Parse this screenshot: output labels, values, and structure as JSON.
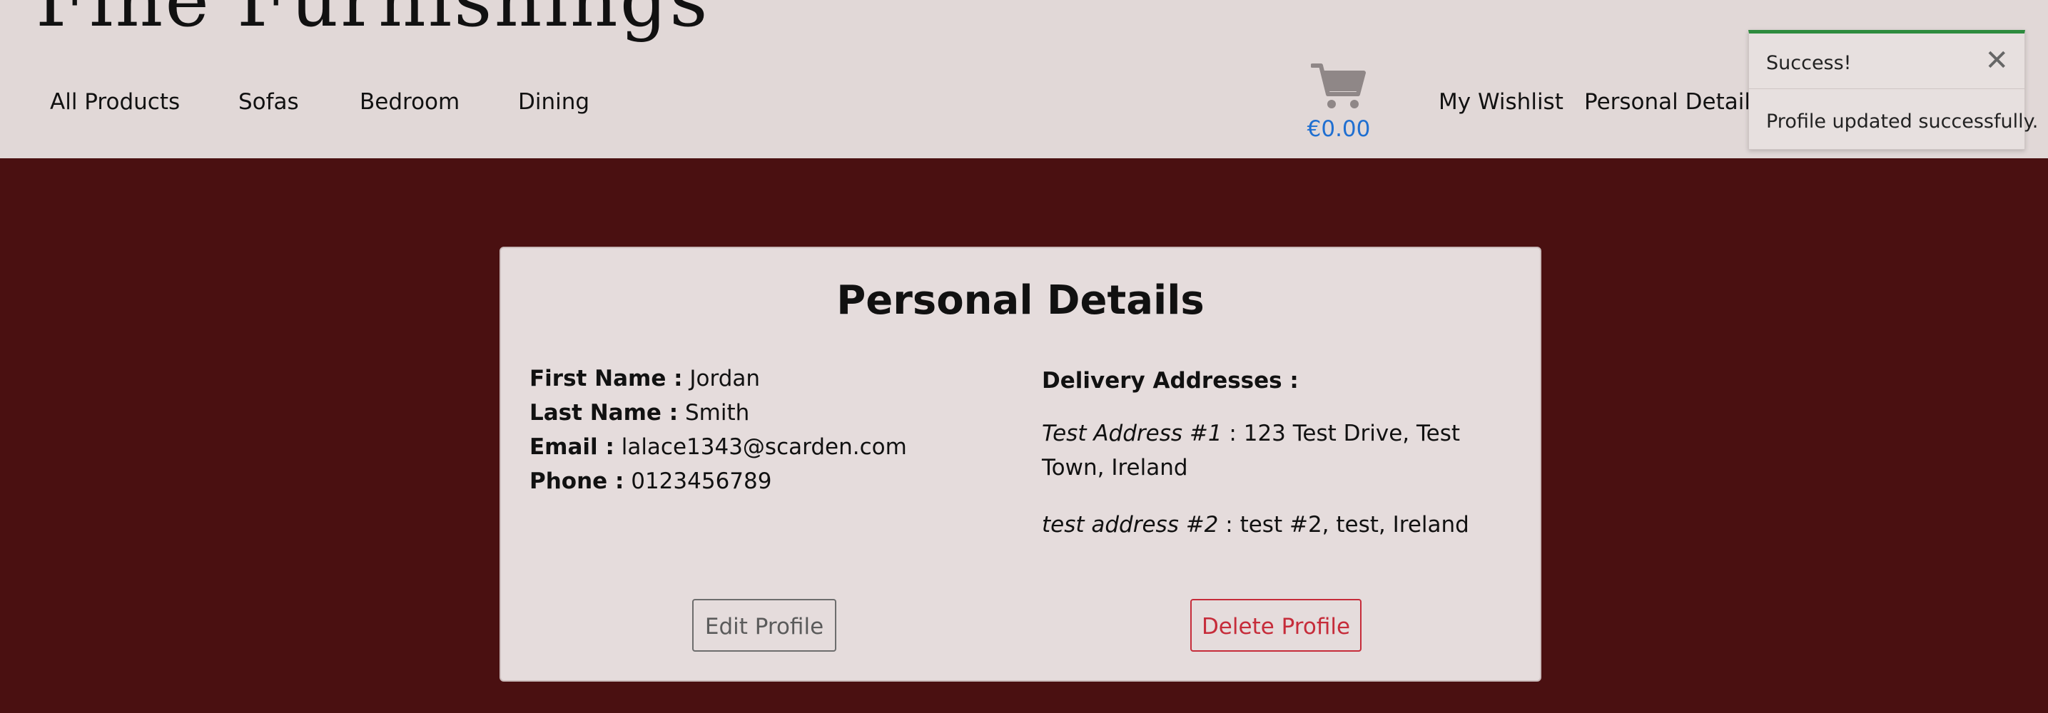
{
  "brand": {
    "logo_text": "Fine Furnishings"
  },
  "nav": {
    "items": [
      {
        "label": "All Products"
      },
      {
        "label": "Sofas"
      },
      {
        "label": "Bedroom"
      },
      {
        "label": "Dining"
      }
    ],
    "cart_total": "€0.00",
    "wishlist_label": "My Wishlist",
    "personal_details_label": "Personal Details"
  },
  "toast": {
    "title": "Success!",
    "close_glyph": "✕",
    "message": "Profile updated successfully."
  },
  "profile": {
    "title": "Personal Details",
    "first_name_label": "First Name :",
    "first_name": "Jordan",
    "last_name_label": "Last Name :",
    "last_name": "Smith",
    "email_label": "Email :",
    "email": "lalace1343@scarden.com",
    "phone_label": "Phone :",
    "phone": "0123456789",
    "addresses_label": "Delivery Addresses :",
    "addresses": [
      {
        "name": "Test Address #1",
        "separator": " : ",
        "detail": "123 Test Drive, Test Town, Ireland"
      },
      {
        "name": "test address #2",
        "separator": " : ",
        "detail": "test #2, test, Ireland"
      }
    ],
    "edit_label": "Edit Profile",
    "delete_label": "Delete Profile"
  },
  "colors": {
    "page_background": "#4a1011",
    "header_background": "#e1d8d7",
    "card_background": "#e5dcdc",
    "price_blue": "#1f6fd1",
    "success_green": "#2e8b3e",
    "danger_red": "#c62c3a"
  },
  "icons": {
    "cart": "shopping-cart-icon",
    "close": "close-icon"
  }
}
